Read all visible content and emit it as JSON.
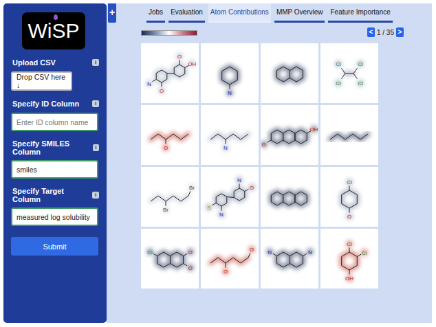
{
  "logo": "WiSP",
  "plus": "+",
  "sidebar": {
    "fields": [
      {
        "label": "Upload CSV",
        "info": "i",
        "kind": "dropzone",
        "text": "Drop CSV here ↓"
      },
      {
        "label": "Specify ID Column",
        "info": "i",
        "kind": "input",
        "placeholder": "Enter ID column name",
        "value": ""
      },
      {
        "label": "Specify SMILES Column",
        "info": "i",
        "kind": "input",
        "placeholder": "",
        "value": "smiles"
      },
      {
        "label": "Specify Target Column",
        "info": "i",
        "kind": "input",
        "placeholder": "",
        "value": "measured log solubility"
      }
    ],
    "submit": "Submit"
  },
  "tabs": [
    {
      "label": "Jobs",
      "selected": false
    },
    {
      "label": "Evaluation",
      "selected": false
    },
    {
      "label": "Atom Contributions",
      "selected": true
    },
    {
      "label": "MMP Overview",
      "selected": false
    },
    {
      "label": "Feature Importance",
      "selected": false
    }
  ],
  "pager": {
    "prev": "<",
    "label": "1 / 35",
    "next": ">"
  },
  "grid": {
    "cells": [
      {
        "kind": "complex",
        "labels": [
          "O",
          "N",
          "O",
          "OH"
        ],
        "color": "#9aa6bd"
      },
      {
        "kind": "ring",
        "labels": [
          "N"
        ],
        "color": "#1b2a4e"
      },
      {
        "kind": "two-rings",
        "labels": [],
        "color": "#1b2a4e"
      },
      {
        "kind": "alkene",
        "labels": [
          "Cl",
          "Cl",
          "Cl",
          "Cl"
        ],
        "color": "#7d8aa5"
      },
      {
        "kind": "chain",
        "labels": [
          "O"
        ],
        "color": "#c0392b"
      },
      {
        "kind": "chain",
        "labels": [
          "N"
        ],
        "color": "#9aa6bd"
      },
      {
        "kind": "three-rings",
        "labels": [
          "O",
          "OH"
        ],
        "color": "#1b2a4e"
      },
      {
        "kind": "chain",
        "labels": [],
        "color": "#1b2a4e"
      },
      {
        "kind": "chain",
        "labels": [
          "Br",
          "Br"
        ],
        "color": "#b8c0d0"
      },
      {
        "kind": "complex",
        "labels": [
          "N",
          "S",
          "N",
          "O"
        ],
        "color": "#7d8aa5"
      },
      {
        "kind": "three-rings",
        "labels": [],
        "color": "#1b2a4e"
      },
      {
        "kind": "ring",
        "labels": [
          "O",
          "Cl"
        ],
        "color": "#7d8aa5"
      },
      {
        "kind": "two-rings",
        "labels": [
          "Cl",
          "O",
          "O"
        ],
        "color": "#1b2a4e"
      },
      {
        "kind": "chain",
        "labels": [
          "O",
          "O"
        ],
        "color": "#c0392b"
      },
      {
        "kind": "two-rings",
        "labels": [
          "N",
          "N"
        ],
        "color": "#1b2a4e"
      },
      {
        "kind": "ring",
        "labels": [
          "OH",
          "Cl",
          "Cl"
        ],
        "color": "#c0392b"
      }
    ]
  }
}
